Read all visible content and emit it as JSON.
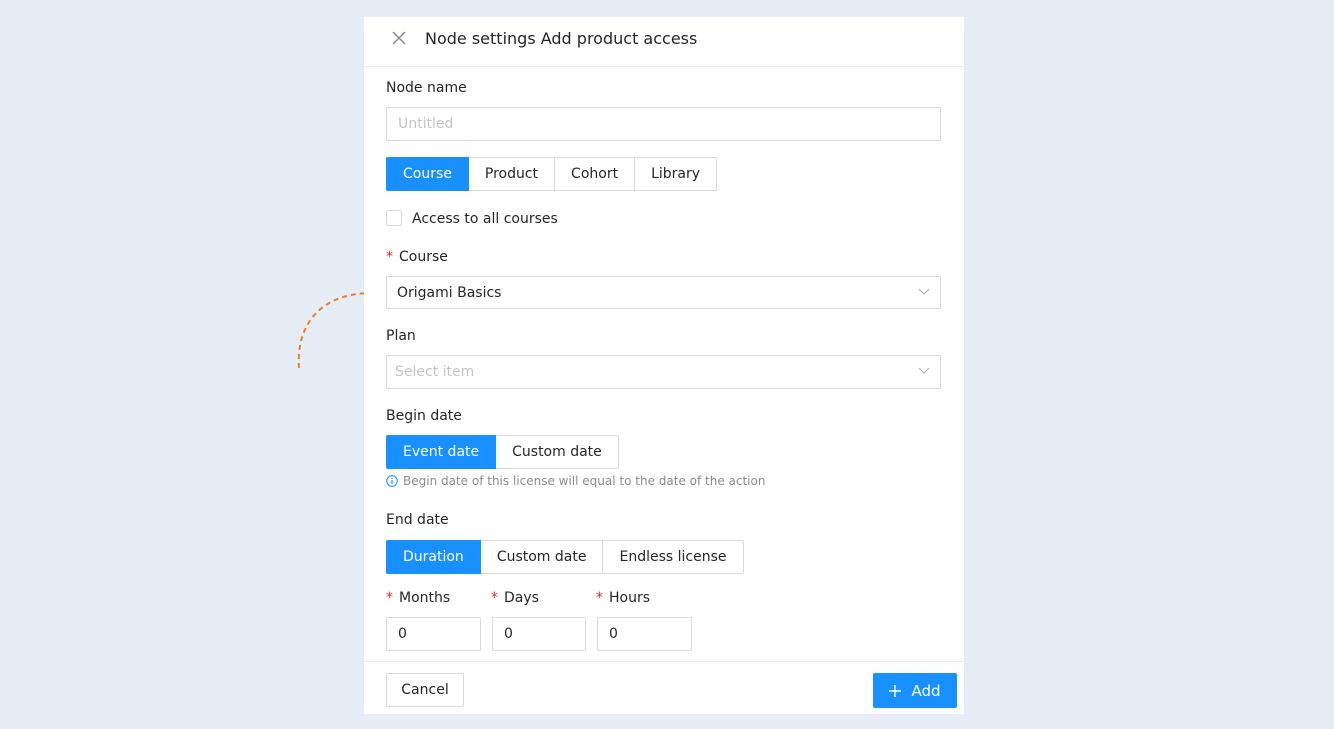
{
  "modal": {
    "title": "Node settings Add product access"
  },
  "node_name": {
    "label": "Node name",
    "value": "",
    "placeholder": "Untitled"
  },
  "product_type_tabs": [
    {
      "label": "Course",
      "active": true
    },
    {
      "label": "Product",
      "active": false
    },
    {
      "label": "Cohort",
      "active": false
    },
    {
      "label": "Library",
      "active": false
    }
  ],
  "access_all": {
    "label": "Access to all courses",
    "checked": false
  },
  "course": {
    "required_mark": "*",
    "label": "Course",
    "selected": "Origami Basics"
  },
  "plan": {
    "label": "Plan",
    "placeholder": "Select item"
  },
  "begin_date": {
    "label": "Begin date",
    "options": [
      {
        "label": "Event date",
        "active": true
      },
      {
        "label": "Custom date",
        "active": false
      }
    ],
    "hint": "Begin date of this license will equal to the date of the action"
  },
  "end_date": {
    "label": "End date",
    "options": [
      {
        "label": "Duration",
        "active": true
      },
      {
        "label": "Custom date",
        "active": false
      },
      {
        "label": "Endless license",
        "active": false
      }
    ]
  },
  "duration": {
    "required_mark": "*",
    "months_label": "Months",
    "months_value": "0",
    "days_label": "Days",
    "days_value": "0",
    "hours_label": "Hours",
    "hours_value": "0"
  },
  "footer": {
    "cancel_label": "Cancel",
    "add_label": "Add"
  },
  "colors": {
    "accent": "#1890ff",
    "required": "#f5222d",
    "annotation_arrow": "#e8822a",
    "background": "#e6edf6"
  }
}
